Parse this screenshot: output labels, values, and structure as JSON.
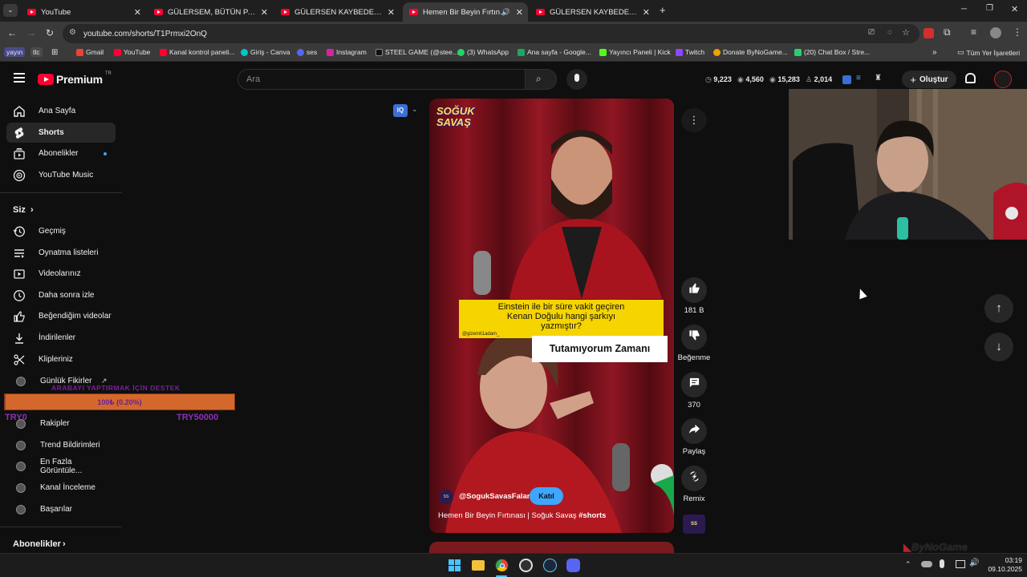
{
  "browser": {
    "tabs": [
      {
        "title": "YouTube",
        "active": false
      },
      {
        "title": "GÜLERSEM, BÜTÜN PARAM Gİ",
        "active": false
      },
      {
        "title": "GÜLERSEN KAYBEDERSİN w/ @",
        "active": false
      },
      {
        "title": "Hemen Bir Beyin Fırtınası | S",
        "active": true
      },
      {
        "title": "GÜLERSEN KAYBEDERSİN w/ @",
        "active": false
      }
    ],
    "url": "youtube.com/shorts/T1Prmxi2OnQ",
    "bookmarks": [
      "yayın",
      "tlc",
      "Gmail",
      "YouTube",
      "Kanal kontrol paneli...",
      "Giriş - Canva",
      "ses",
      "Instagram",
      "STEEL GAME (@stee...",
      "(3) WhatsApp",
      "Ana sayfa - Google...",
      "Yayıncı Paneli | Kick",
      "Twitch",
      "Donate ByNoGame...",
      "(20) Chat Box / Stre..."
    ],
    "all_bookmarks": "Tüm Yer İşaretleri"
  },
  "youtube": {
    "logo": "Premium",
    "logo_badge": "TR",
    "search_placeholder": "Ara",
    "stats": [
      "9,223",
      "4,560",
      "15,283",
      "2,014"
    ],
    "create_label": "Oluştur"
  },
  "sidebar": {
    "main": [
      {
        "label": "Ana Sayfa",
        "icon": "home-icon"
      },
      {
        "label": "Shorts",
        "icon": "shorts-icon"
      },
      {
        "label": "Abonelikler",
        "icon": "subscriptions-icon"
      },
      {
        "label": "YouTube Music",
        "icon": "music-icon"
      }
    ],
    "you_header": "Siz",
    "you": [
      {
        "label": "Geçmiş",
        "icon": "history-icon"
      },
      {
        "label": "Oynatma listeleri",
        "icon": "playlist-icon"
      },
      {
        "label": "Videolarınız",
        "icon": "videos-icon"
      },
      {
        "label": "Daha sonra izle",
        "icon": "clock-icon"
      },
      {
        "label": "Beğendiğim videolar",
        "icon": "like-icon"
      },
      {
        "label": "İndirilenler",
        "icon": "download-icon"
      },
      {
        "label": "Klipleriniz",
        "icon": "scissors-icon"
      }
    ],
    "channels": [
      "Günlük Fikirler",
      "Rakipler",
      "Trend Bildirimleri",
      "En Fazla Görüntüle...",
      "Kanal İnceleme",
      "Başarılar"
    ],
    "subscriptions_header": "Abonelikler"
  },
  "donation_overlay": {
    "title": "ARABAYI YAPTIRMAK İÇİN DESTEK",
    "progress_text": "100₺ (0.20%)",
    "progress_fraction": 0.002,
    "min": "TRY0",
    "max": "TRY50000"
  },
  "short": {
    "show_logo_line1": "SOĞUK",
    "show_logo_line2": "SAVAŞ",
    "question": "Einstein ile bir süre vakit geçiren Kenan Doğulu hangi şarkıyı yazmıştır?",
    "question_handle": "@gizemli1adam_",
    "caption": "Tutamıyorum Zamanı",
    "channel": "@SogukSavasFalan",
    "join_label": "Katıl",
    "title": "Hemen Bir Beyin Fırtınası | Soğuk Savaş",
    "hashtag": "#shorts",
    "iq_badge": "IQ"
  },
  "actions": {
    "likes": "181 B",
    "dislike_label": "Beğenme",
    "comments": "370",
    "share_label": "Paylaş",
    "remix_label": "Remix"
  },
  "stream_watermark": "ByNoGame",
  "clock": {
    "time": "03:19",
    "date": "09.10.2025"
  },
  "colors": {
    "accent_red": "#ff0033",
    "donation_orange": "#d4682c",
    "caption_yellow": "#f5d400"
  }
}
